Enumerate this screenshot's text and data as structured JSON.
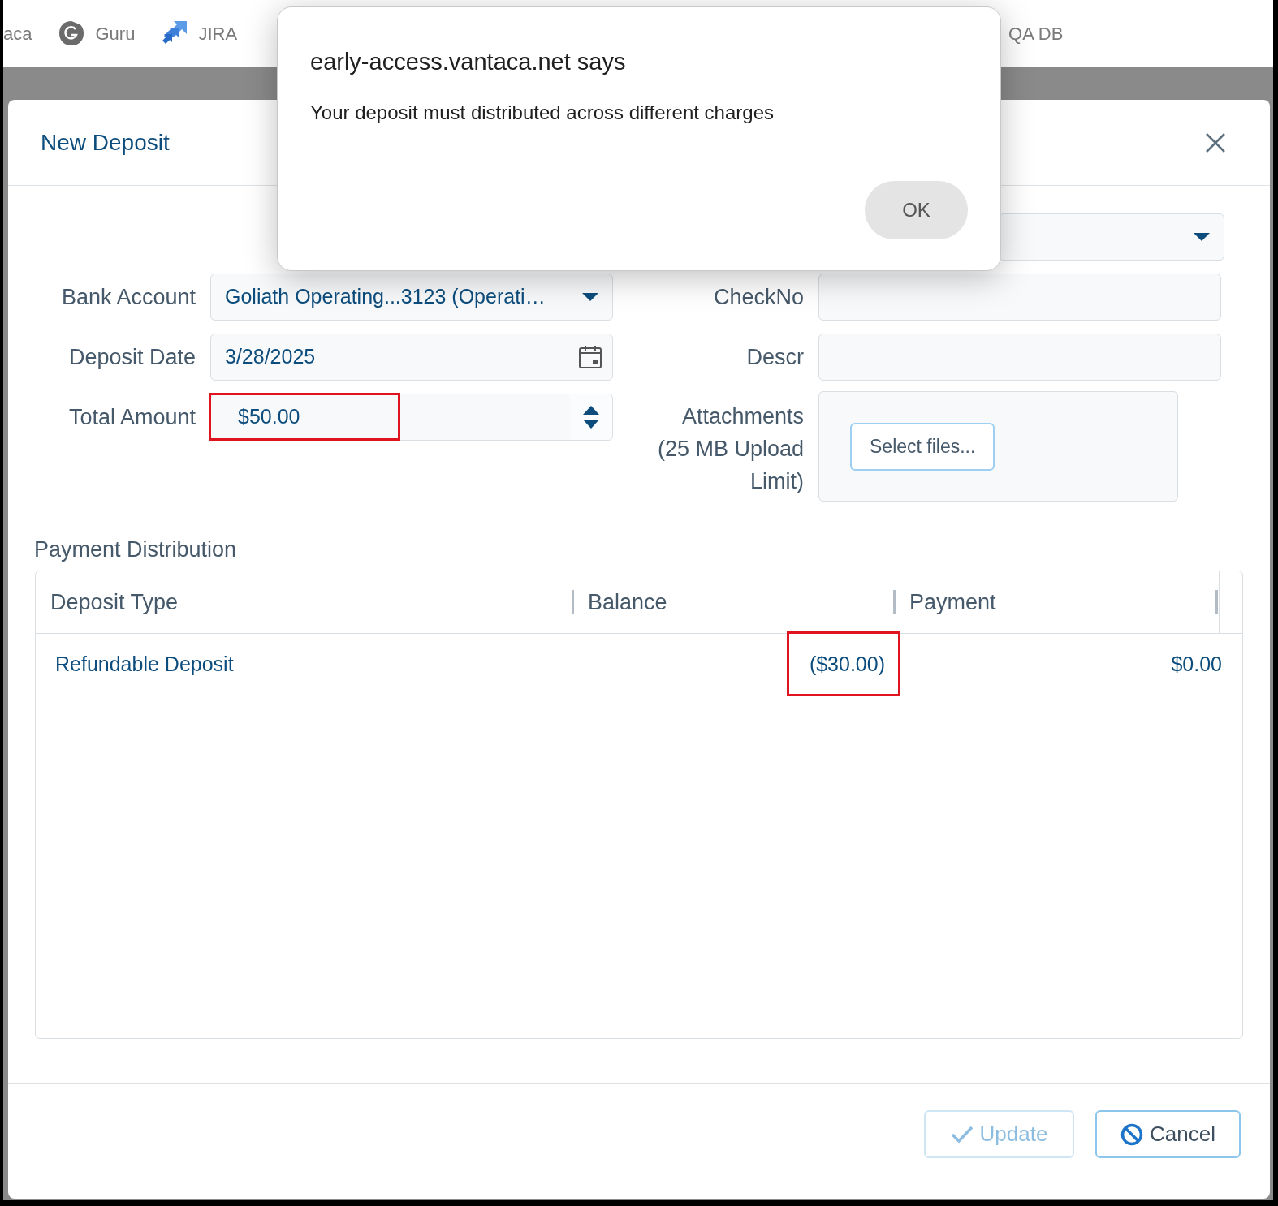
{
  "bookmarks": [
    {
      "label": "aca",
      "kind": "plain"
    },
    {
      "label": "Guru",
      "kind": "guru"
    },
    {
      "label": "JIRA",
      "kind": "jira"
    },
    {
      "label": "QA DB",
      "kind": "plain"
    }
  ],
  "alert": {
    "title": "early-access.vantaca.net says",
    "message": "Your deposit must distributed across different charges",
    "button": "OK"
  },
  "modal": {
    "title": "New Deposit"
  },
  "form": {
    "left": [
      {
        "label": "Bank Account",
        "value": "Goliath Operating...3123 (Operati…",
        "kind": "select",
        "highlighted": false
      },
      {
        "label": "Deposit Date",
        "value": "3/28/2025",
        "kind": "date",
        "highlighted": false
      },
      {
        "label": "Total Amount",
        "value": "$50.00",
        "kind": "number",
        "highlighted": true
      }
    ],
    "right": [
      {
        "label": "CheckNo",
        "kind": "text"
      },
      {
        "label": "Descr",
        "kind": "text"
      },
      {
        "label": "Attachments (25 MB Upload Limit)",
        "kind": "upload",
        "button": "Select files..."
      }
    ]
  },
  "distribution": {
    "title": "Payment Distribution",
    "columns": [
      "Deposit Type",
      "Balance",
      "Payment"
    ],
    "rows": [
      {
        "deposit_type": "Refundable Deposit",
        "balance": "($30.00)",
        "payment": "$0.00",
        "balance_highlighted": true
      }
    ]
  },
  "buttons": [
    {
      "label": "Update",
      "kind": "update",
      "disabled": true
    },
    {
      "label": "Cancel",
      "kind": "cancel",
      "disabled": false
    }
  ]
}
